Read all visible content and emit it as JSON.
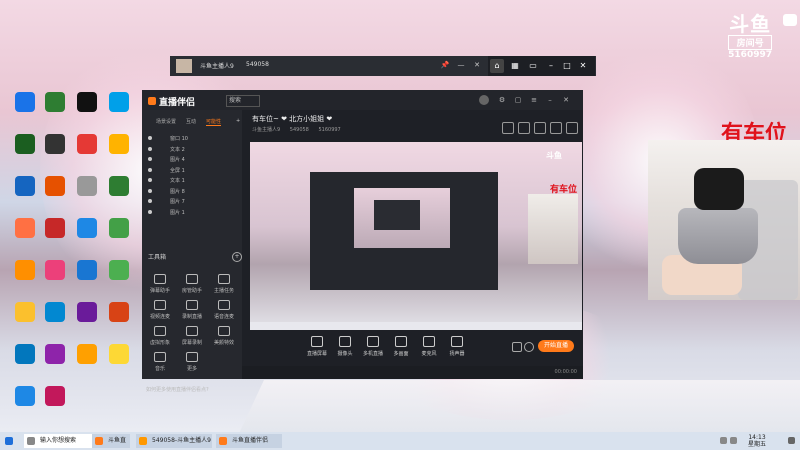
{
  "desktop": {
    "icons": [
      {
        "label": "",
        "color": "#1a73e8"
      },
      {
        "label": "",
        "color": "#2e7d32"
      },
      {
        "label": "",
        "color": "#111"
      },
      {
        "label": "",
        "color": "#00a0e9"
      },
      {
        "label": "",
        "color": "#1b5e20"
      },
      {
        "label": "",
        "color": "#333"
      },
      {
        "label": "",
        "color": "#e53935"
      },
      {
        "label": "",
        "color": "#ffb300"
      },
      {
        "label": "",
        "color": "#1565c0"
      },
      {
        "label": "",
        "color": "#e65100"
      },
      {
        "label": "",
        "color": "#999"
      },
      {
        "label": "",
        "color": "#2e7d32"
      },
      {
        "label": "",
        "color": "#ff7043"
      },
      {
        "label": "",
        "color": "#c62828"
      },
      {
        "label": "",
        "color": "#1e88e5"
      },
      {
        "label": "",
        "color": "#43a047"
      },
      {
        "label": "",
        "color": "#ff8f00"
      },
      {
        "label": "",
        "color": "#ec407a"
      },
      {
        "label": "",
        "color": "#1976d2"
      },
      {
        "label": "",
        "color": "#4caf50"
      },
      {
        "label": "",
        "color": "#fbc02d"
      },
      {
        "label": "",
        "color": "#0288d1"
      },
      {
        "label": "",
        "color": "#6a1b9a"
      },
      {
        "label": "",
        "color": "#d84315"
      },
      {
        "label": "",
        "color": "#0277bd"
      },
      {
        "label": "",
        "color": "#8e24aa"
      },
      {
        "label": "",
        "color": "#ffa000"
      },
      {
        "label": "",
        "color": "#fdd835"
      },
      {
        "label": "",
        "color": "#1e88e5"
      },
      {
        "label": "",
        "color": "#c2185b"
      }
    ]
  },
  "watermark": {
    "logo": "斗鱼",
    "room_label": "房间号",
    "room_number": "5160997"
  },
  "side_title": "有车位",
  "window1": {
    "user": "斗鱼主播人9",
    "room": "549058",
    "buttons": [
      "📌",
      "—",
      "✕"
    ]
  },
  "app": {
    "title": "直播伴侣",
    "search_placeholder": "搜索",
    "tabs": [
      "场景设置",
      "互动",
      "可能性"
    ],
    "scenes": [
      "窗口 10",
      "文本 2",
      "图片 4",
      "全屏 1",
      "文本 1",
      "图片 8",
      "图片 7",
      "图片 1"
    ],
    "tools_title": "工具箱",
    "tools": [
      "弹幕助手",
      "房管助手",
      "主播任务",
      "视频连麦",
      "录制直播",
      "语音连麦",
      "虚拟形象",
      "屏幕录制",
      "美颜特效",
      "音乐",
      "更多"
    ],
    "ad_text": "如何更多使用直播伴侣看点?",
    "live_title": "有车位~ ❤ 北方小姐姐 ❤",
    "live_meta": [
      "斗鱼主播人9",
      "549058",
      "5160997"
    ],
    "preview_text": "有车位",
    "bottom_items": [
      "直播屏幕",
      "摄像头",
      "多机直播",
      "多画面",
      "麦克风",
      "扬声器"
    ],
    "live_button": "开始直播",
    "status_text": "00:00:00"
  },
  "taskbar": {
    "items": [
      "输入你想搜索",
      "斗鱼直播伴侣",
      "549058-斗鱼主播人9",
      "斗鱼直播伴侣"
    ],
    "time": "14:13",
    "date": "星期五"
  }
}
